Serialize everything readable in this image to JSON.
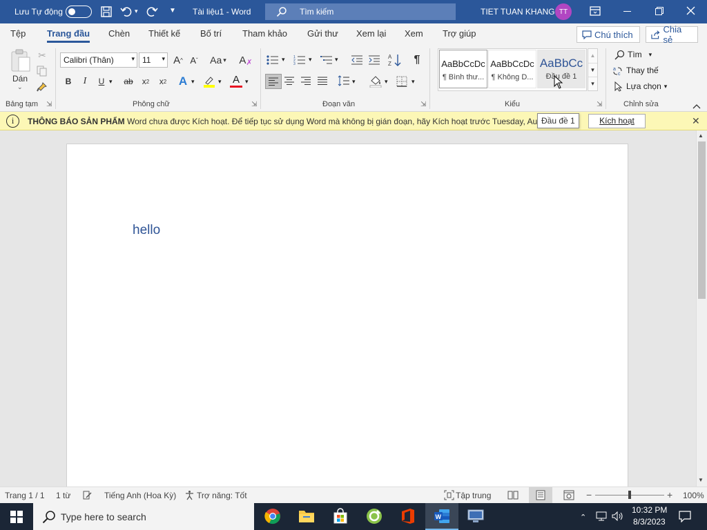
{
  "titlebar": {
    "autosave_label": "Lưu Tự động",
    "doc_title": "Tài liệu1  -  Word",
    "search_placeholder": "Tìm kiếm",
    "user_name": "TIET TUAN KHANG",
    "user_initials": "TT"
  },
  "tabs": [
    "Tệp",
    "Trang đầu",
    "Chèn",
    "Thiết kế",
    "Bố trí",
    "Tham khảo",
    "Gửi thư",
    "Xem lại",
    "Xem",
    "Trợ giúp"
  ],
  "share": {
    "comment_label": "Chú thích",
    "share_label": "Chia sẻ"
  },
  "ribbon": {
    "clipboard": {
      "paste_label": "Dán",
      "group_label": "Bảng tạm"
    },
    "font": {
      "font_name": "Calibri (Thân)",
      "font_size": "11",
      "change_case": "Aa",
      "group_label": "Phông chữ"
    },
    "paragraph": {
      "group_label": "Đoạn văn"
    },
    "styles": {
      "group_label": "Kiểu",
      "items": [
        {
          "sample": "AaBbCcDc",
          "name": "¶ Bình thư..."
        },
        {
          "sample": "AaBbCcDc",
          "name": "¶ Không D..."
        },
        {
          "sample": "AaBbCc",
          "name": "Đầu đề 1"
        }
      ],
      "tooltip": "Đầu đề 1"
    },
    "editing": {
      "find_label": "Tìm",
      "replace_label": "Thay thế",
      "select_label": "Lựa chọn",
      "group_label": "Chỉnh sửa"
    }
  },
  "message_bar": {
    "title": "THÔNG BÁO SẢN PHẨM",
    "text": "Word chưa được Kích hoạt. Để tiếp tục sử dụng Word mà không bị gián đoạn, hãy Kích hoạt trước Tuesday, Augu",
    "button_label": "Kích hoạt"
  },
  "document": {
    "body_text": "hello"
  },
  "status": {
    "page": "Trang 1 / 1",
    "words": "1 từ",
    "language": "Tiếng Anh (Hoa Kỳ)",
    "accessibility": "Trợ năng: Tốt",
    "focus": "Tập trung",
    "zoom": "100%"
  },
  "taskbar": {
    "search_placeholder": "Type here to search",
    "time": "10:32 PM",
    "date": "8/3/2023"
  },
  "colors": {
    "word_blue": "#2b579a",
    "message_yellow": "#fcf7b6",
    "avatar": "#b146c2",
    "heading_blue": "#2f5496"
  }
}
